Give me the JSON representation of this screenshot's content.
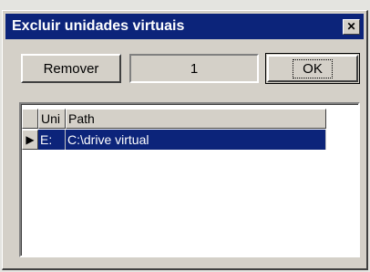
{
  "window": {
    "title": "Excluir unidades virtuais",
    "close_glyph": "✕"
  },
  "toolbar": {
    "remove_label": "Remover",
    "count_value": "1",
    "ok_label": "OK"
  },
  "grid": {
    "columns": [
      "Uni",
      "Path"
    ],
    "rows": [
      {
        "unit": "E:",
        "path": "C:\\drive virtual",
        "selected": true
      }
    ],
    "current_row_indicator": "▶"
  },
  "colors": {
    "titlebar": "#0c247a",
    "selection": "#0c247a",
    "face": "#d4d0c8"
  }
}
